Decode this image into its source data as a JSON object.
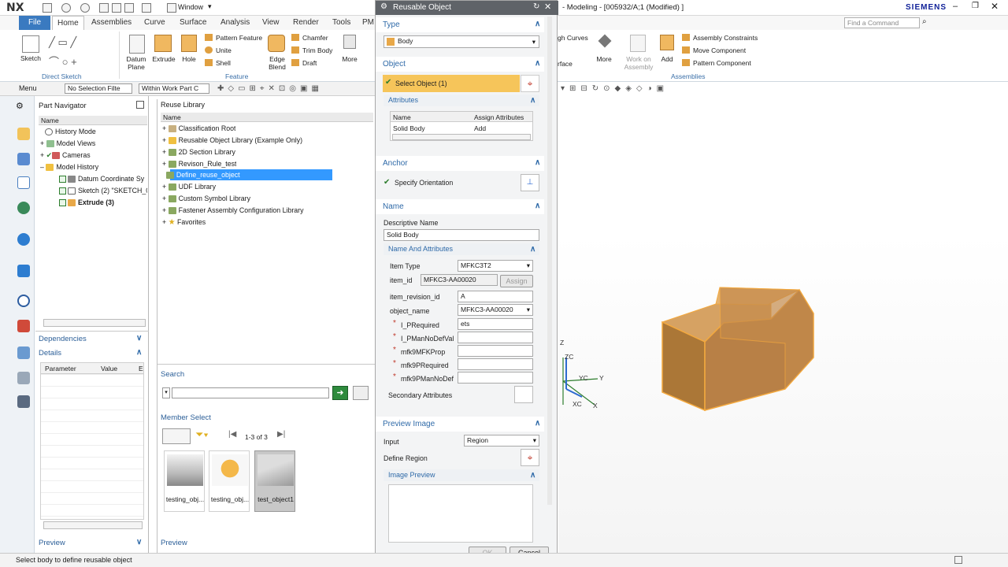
{
  "window": {
    "logo": "NX",
    "window_menu": "Window",
    "title": "- Modeling - [005932/A;1 (Modified) ]",
    "brand": "SIEMENS",
    "command_placeholder": "Find a Command"
  },
  "menubar": {
    "file": "File",
    "tabs": [
      "Home",
      "Assemblies",
      "Curve",
      "Surface",
      "Analysis",
      "View",
      "Render",
      "Tools",
      "PM"
    ]
  },
  "ribbon": {
    "sketch": "Sketch",
    "direct_sketch": "Direct Sketch",
    "datum_plane": "Datum Plane",
    "extrude": "Extrude",
    "hole": "Hole",
    "pattern_feature": "Pattern Feature",
    "unite": "Unite",
    "shell": "Shell",
    "edge_blend": "Edge Blend",
    "chamfer": "Chamfer",
    "trim_body": "Trim Body",
    "draft": "Draft",
    "more": "More",
    "feature": "Feature",
    "gh_curves": "gh Curves",
    "rface": "rface",
    "more2": "More",
    "work_on_assembly": "Work on Assembly",
    "add": "Add",
    "assembly_constraints": "Assembly Constraints",
    "move_component": "Move Component",
    "pattern_component": "Pattern Component",
    "assemblies": "Assemblies"
  },
  "toolbar": {
    "menu": "Menu",
    "selection_filter": "No Selection Filte",
    "scope": "Within Work Part C"
  },
  "part_navigator": {
    "title": "Part Navigator",
    "col_name": "Name",
    "items": [
      {
        "label": "History Mode"
      },
      {
        "label": "Model Views"
      },
      {
        "label": "Cameras"
      },
      {
        "label": "Model History"
      },
      {
        "label": "Datum Coordinate Sy"
      },
      {
        "label": "Sketch (2) \"SKETCH_0"
      },
      {
        "label": "Extrude (3)"
      }
    ],
    "dependencies": "Dependencies",
    "details": "Details",
    "col_parameter": "Parameter",
    "col_value": "Value",
    "col_e": "E",
    "preview": "Preview"
  },
  "reuse_library": {
    "title": "Reuse Library",
    "col_name": "Name",
    "items": [
      {
        "label": "Classification Root"
      },
      {
        "label": "Reusable Object Library (Example Only)"
      },
      {
        "label": "2D Section Library"
      },
      {
        "label": "Revison_Rule_test"
      },
      {
        "label": "Define_reuse_object"
      },
      {
        "label": "UDF Library"
      },
      {
        "label": "Custom Symbol Library"
      },
      {
        "label": "Fastener Assembly Configuration Library"
      },
      {
        "label": "Favorites"
      }
    ],
    "search": "Search",
    "member_select": "Member Select",
    "page_info": "1-3 of 3",
    "thumbs": [
      {
        "label": "testing_obj..."
      },
      {
        "label": "testing_obj..."
      },
      {
        "label": "test_object1"
      }
    ],
    "preview": "Preview"
  },
  "dialog": {
    "title": "Reusable Object",
    "type_head": "Type",
    "type_value": "Body",
    "object_head": "Object",
    "select_object": "Select Object (1)",
    "attributes_head": "Attributes",
    "attr_col_name": "Name",
    "attr_col_assign": "Assign Attributes",
    "attr_row_name": "Solid Body",
    "attr_row_value": "Add",
    "anchor_head": "Anchor",
    "specify_orientation": "Specify Orientation",
    "name_head": "Name",
    "descriptive_name_label": "Descriptive Name",
    "descriptive_name_value": "Solid Body",
    "name_attrs_head": "Name And Attributes",
    "item_type_label": "Item Type",
    "item_type_value": "MFKC3T2",
    "item_id_label": "item_id",
    "item_id_value": "MFKC3-AA00020",
    "assign": "Assign",
    "item_revision_id_label": "item_revision_id",
    "item_revision_id_value": "A",
    "object_name_label": "object_name",
    "object_name_value": "MFKC3-AA00020",
    "i_prequired_label": "I_PRequired",
    "i_prequired_value": "ets",
    "i_pmannodefval_label": "I_PManNoDefVal",
    "mfk9mfkprop_label": "mfk9MFKProp",
    "mfk9prequired_label": "mfk9PRequired",
    "mfk9pmannodef_label": "mfk9PManNoDef",
    "secondary_attributes": "Secondary Attributes",
    "preview_image_head": "Preview Image",
    "input_label": "Input",
    "input_value": "Region",
    "define_region": "Define Region",
    "image_preview": "Image Preview",
    "ok": "OK",
    "cancel": "Cancel"
  },
  "viewport": {
    "axis_z": "Z",
    "axis_zc": "ZC",
    "axis_yc": "YC",
    "axis_y": "Y",
    "axis_xc": "XC",
    "axis_x": "X"
  },
  "status": {
    "message": "Select body to define reusable object"
  },
  "colors": {
    "accent": "#3a7ac0",
    "selection_highlight": "#f6c55a",
    "tree_selected": "#3399ff",
    "body_fill": "#c8945a"
  }
}
